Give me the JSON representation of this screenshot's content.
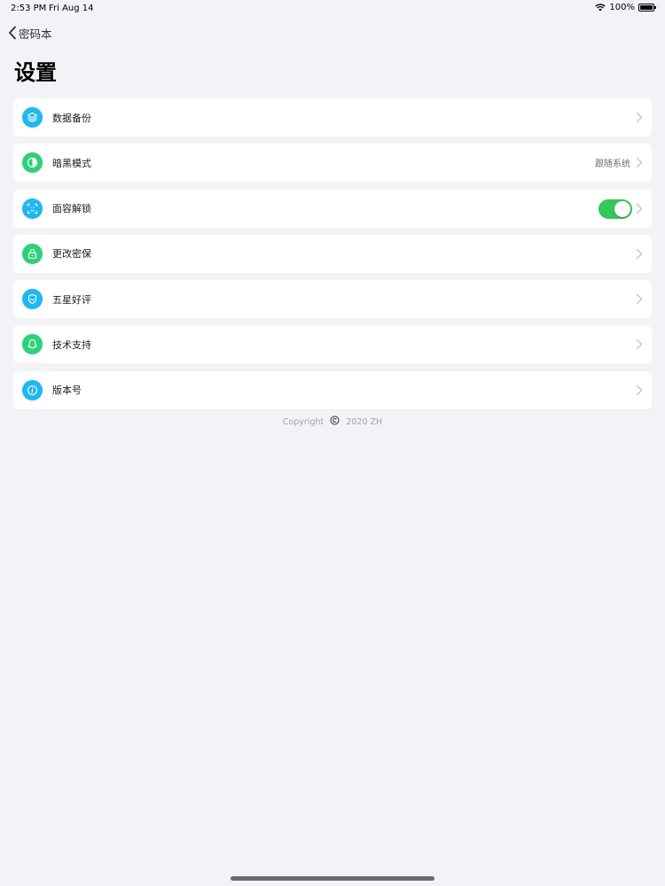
{
  "status_bar": {
    "time": "2:53 PM",
    "date": "Fri Aug 14",
    "battery": "100%",
    "battery_level": 1.0
  },
  "nav": {
    "back_label": "密码本",
    "title": "设置"
  },
  "colors": {
    "accent_blue": "#1fb8f0",
    "accent_green": "#2fd07a",
    "toggle_on": "#34c759",
    "background": "#f2f2f7"
  },
  "settings": {
    "items": [
      {
        "label": "数据备份",
        "icon": "layers-icon",
        "value": ""
      },
      {
        "label": "暗黑模式",
        "icon": "contrast-icon",
        "value": "跟随系统"
      },
      {
        "label": "面容解锁",
        "icon": "face-id-icon",
        "value": "",
        "toggle_on": true
      },
      {
        "label": "更改密保",
        "icon": "lock-icon",
        "value": ""
      },
      {
        "label": "五星好评",
        "icon": "badge-icon",
        "value": ""
      },
      {
        "label": "技术支持",
        "icon": "qq-icon",
        "value": ""
      },
      {
        "label": "版本号",
        "icon": "info-icon",
        "value": ""
      }
    ]
  },
  "footer": {
    "copyright_prefix": "Copyright",
    "copyright_suffix": "2020 ZH"
  }
}
